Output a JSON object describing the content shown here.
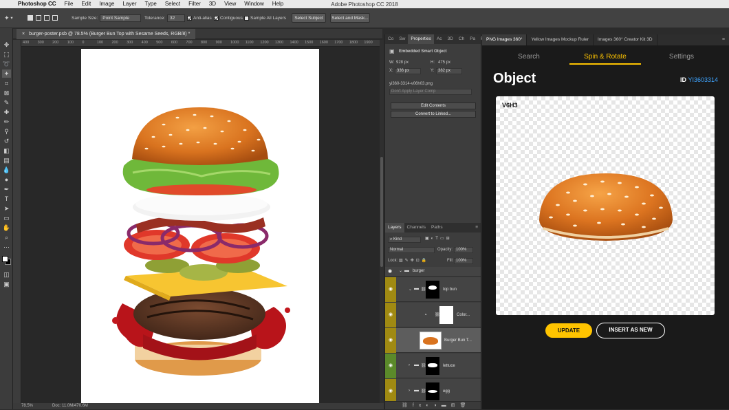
{
  "menubar": {
    "app": "Photoshop CC",
    "items": [
      "File",
      "Edit",
      "Image",
      "Layer",
      "Type",
      "Select",
      "Filter",
      "3D",
      "View",
      "Window",
      "Help"
    ],
    "window_title": "Adobe Photoshop CC 2018"
  },
  "options": {
    "sample_size_label": "Sample Size:",
    "sample_size_value": "Point Sample",
    "tolerance_label": "Tolerance:",
    "tolerance_value": "32",
    "anti_alias": "Anti-alias",
    "contiguous": "Contiguous",
    "sample_all_layers": "Sample All Layers",
    "select_subject": "Select Subject",
    "select_and_mask": "Select and Mask..."
  },
  "document": {
    "tab_title": "burger-poster.psb @ 78.5% (Burger Bun Top with Sesame Seeds, RGB/8) *",
    "ruler_ticks": [
      "400",
      "300",
      "200",
      "100",
      "0",
      "100",
      "200",
      "300",
      "400",
      "500",
      "600",
      "700",
      "800",
      "900",
      "1000",
      "1100",
      "1200",
      "1300",
      "1400",
      "1500",
      "1600",
      "1700",
      "1800",
      "1900"
    ],
    "zoom": "78.5%",
    "doc_size": "Doc: 11.0M/470.6M"
  },
  "properties": {
    "tabs": [
      "Co",
      "Sw",
      "Properties",
      "Ac",
      "3D",
      "Ch",
      "Pa",
      "Pan"
    ],
    "header": "Embedded Smart Object",
    "w_label": "W:",
    "w_value": "928 px",
    "h_label": "H:",
    "h_value": "475 px",
    "x_label": "X:",
    "x_value": "336 px",
    "y_label": "Y:",
    "y_value": "382 px",
    "filename": "yi360-3314-v06h03.png",
    "layer_comp": "Don't Apply Layer Comp",
    "edit_contents": "Edit Contents",
    "convert_linked": "Convert to Linked..."
  },
  "layers_panel": {
    "tabs": [
      "Layers",
      "Channels",
      "Paths"
    ],
    "filter_kind": "Kind",
    "blend_mode": "Normal",
    "opacity_label": "Opacity:",
    "opacity_value": "100%",
    "lock_label": "Lock:",
    "fill_label": "Fill:",
    "fill_value": "100%",
    "group_name": "burger",
    "layers": [
      {
        "name": "top bun"
      },
      {
        "name": "Color..."
      },
      {
        "name": "Burger Bun T..."
      },
      {
        "name": "lettuce"
      },
      {
        "name": "egg"
      }
    ]
  },
  "plugin": {
    "tabs": [
      "PNG Images 360°",
      "Yellow Images Mockup Ruler",
      "Images 360° Creator Kit 3D"
    ],
    "nav": [
      "Search",
      "Spin & Rotate",
      "Settings"
    ],
    "title": "Object",
    "id_label": "ID",
    "id_value": "YI3603314",
    "view_label": "V6H3",
    "update": "UPDATE",
    "insert": "INSERT AS NEW"
  },
  "colors": {
    "accent": "#ffc400",
    "id_link": "#3fa4ff",
    "layer_eye_yellow": "#a08a12",
    "layer_eye_green": "#5b8a2a"
  }
}
